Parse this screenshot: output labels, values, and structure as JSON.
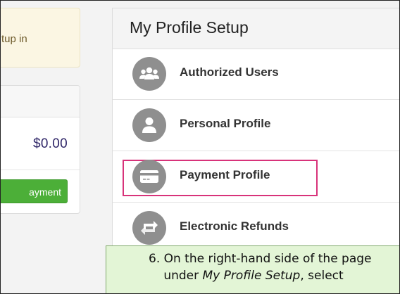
{
  "notice": {
    "text": "tup in"
  },
  "balance": {
    "amount": "$0.00",
    "pay_button_label": "ayment"
  },
  "profile_setup": {
    "title": "My Profile Setup",
    "items": [
      {
        "label": "Authorized Users",
        "icon": "users-icon"
      },
      {
        "label": "Personal Profile",
        "icon": "person-icon"
      },
      {
        "label": "Payment Profile",
        "icon": "credit-card-icon",
        "highlighted": true
      },
      {
        "label": "Electronic Refunds",
        "icon": "refund-arrows-icon"
      }
    ]
  },
  "caption": {
    "line1": "6. On the right-hand side of the page",
    "line2_prefix": "under ",
    "line2_emphasis": "My Profile Setup",
    "line2_suffix": ", select"
  },
  "colors": {
    "highlight_border": "#d8337a",
    "pay_button": "#4caf38",
    "caption_background": "#e3f5d6",
    "icon_circle": "#8f8f8f"
  }
}
